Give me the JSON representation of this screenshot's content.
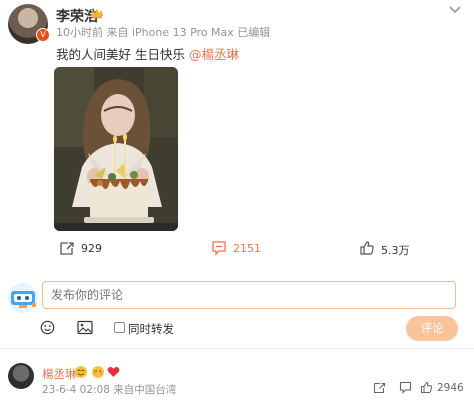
{
  "post": {
    "author": "李荣浩",
    "meta": "10小时前  来自 iPhone 13 Pro Max  已编辑",
    "text_prefix": "我的人间美好 生日快乐 ",
    "mention": "@楊丞琳",
    "actions": {
      "reposts": "929",
      "comments": "2151",
      "likes": "5.3万"
    }
  },
  "comment_box": {
    "placeholder": "发布你的评论",
    "repost_label": "同时转发",
    "submit_label": "评论"
  },
  "comment": {
    "author": "楊丞琳",
    "meta": "23-6-4 02:08  来自中国台湾",
    "likes": "2946"
  },
  "colors": {
    "accent": "#eb7350",
    "muted": "#939393"
  }
}
